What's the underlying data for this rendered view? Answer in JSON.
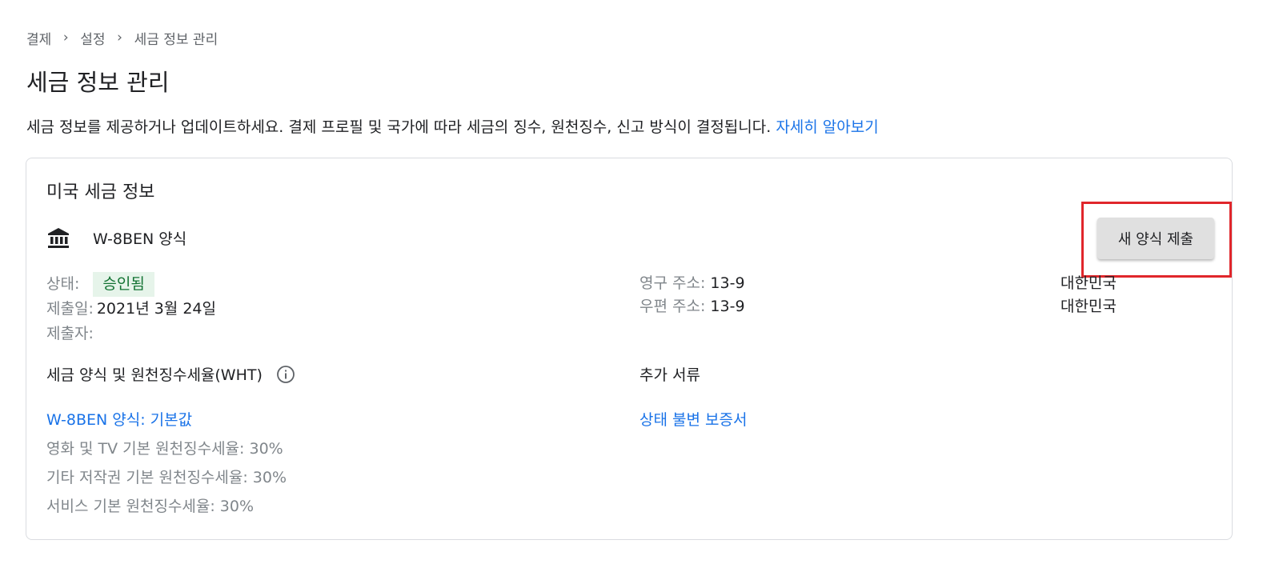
{
  "breadcrumb": {
    "items": [
      "결제",
      "설정",
      "세금 정보 관리"
    ],
    "separator": "›"
  },
  "page": {
    "title": "세금 정보 관리",
    "description": "세금 정보를 제공하거나 업데이트하세요. 결제 프로필 및 국가에 따라 세금의 징수, 원천징수, 신고 방식이 결정됩니다.",
    "learn_more": "자세히 알아보기"
  },
  "card": {
    "title": "미국 세금 정보",
    "form_icon": "bank-icon",
    "form_name": "W-8BEN 양식",
    "submit_button": "새 양식 제출",
    "status_label": "상태:",
    "status_value": "승인됨",
    "submitted_label": "제출일:",
    "submitted_value": "2021년 3월 24일",
    "submitter_label": "제출자:",
    "permanent_address_label": "영구 주소:",
    "permanent_address_value": "13-9",
    "mailing_address_label": "우편 주소:",
    "mailing_address_value": "13-9",
    "permanent_country": "대한민국",
    "mailing_country": "대한민국",
    "wht_heading": "세금 양식 및 원천징수세율(WHT)",
    "wht_info_icon": "info-icon",
    "wht_form_link": "W-8BEN 양식: 기본값",
    "wht_rates": [
      "영화 및 TV 기본 원천징수세율: 30%",
      "기타 저작권 기본 원천징수세율: 30%",
      "서비스 기본 원천징수세율: 30%"
    ],
    "additional_docs_heading": "추가 서류",
    "additional_docs_link": "상태 불변 보증서"
  },
  "colors": {
    "link": "#1a73e8",
    "status_badge_bg": "#e6f4ea",
    "status_badge_text": "#137333",
    "highlight_border": "#e0262b",
    "button_bg": "#e0e0e0"
  }
}
